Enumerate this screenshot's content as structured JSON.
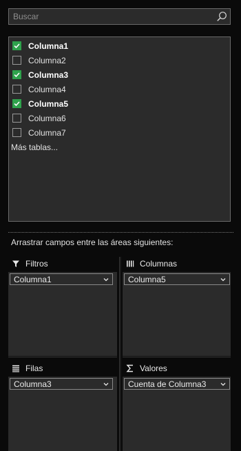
{
  "search": {
    "placeholder": "Buscar",
    "icon": "search-icon"
  },
  "fields": [
    {
      "label": "Columna1",
      "checked": true
    },
    {
      "label": "Columna2",
      "checked": false
    },
    {
      "label": "Columna3",
      "checked": true
    },
    {
      "label": "Columna4",
      "checked": false
    },
    {
      "label": "Columna5",
      "checked": true
    },
    {
      "label": "Columna6",
      "checked": false
    },
    {
      "label": "Columna7",
      "checked": false
    }
  ],
  "more_tables": "Más tablas...",
  "drag_hint": "Arrastrar campos entre las áreas siguientes:",
  "areas": {
    "filters": {
      "title": "Filtros",
      "icon": "filter-icon",
      "items": [
        "Columna1"
      ]
    },
    "columns": {
      "title": "Columnas",
      "icon": "columns-icon",
      "items": [
        "Columna5"
      ]
    },
    "rows": {
      "title": "Filas",
      "icon": "rows-icon",
      "items": [
        "Columna3"
      ]
    },
    "values": {
      "title": "Valores",
      "icon": "sigma-icon",
      "items": [
        "Cuenta de Columna3"
      ]
    }
  },
  "colors": {
    "background": "#0a0a0a",
    "panel": "#2b2b2b",
    "check_accent": "#2fa24c",
    "border": "#6a6a6a"
  }
}
